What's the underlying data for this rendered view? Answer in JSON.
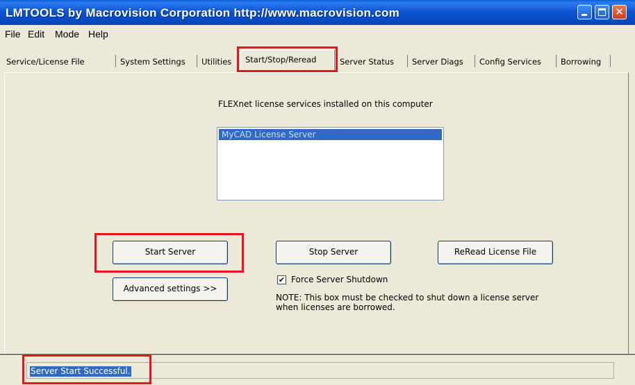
{
  "window": {
    "title": "LMTOOLS by Macrovision Corporation http://www.macrovision.com",
    "controls": [
      "minimize-icon",
      "maximize-icon",
      "close-icon"
    ]
  },
  "menu": [
    "File",
    "Edit",
    "Mode",
    "Help"
  ],
  "tabs": [
    {
      "label": "Service/License File"
    },
    {
      "label": "System Settings"
    },
    {
      "label": "Utilities"
    },
    {
      "label": "Start/Stop/Reread",
      "active": true
    },
    {
      "label": "Server Status"
    },
    {
      "label": "Server Diags"
    },
    {
      "label": "Config Services"
    },
    {
      "label": "Borrowing"
    }
  ],
  "main": {
    "services_caption": "FLEXnet license services installed on this computer",
    "services": [
      "MyCAD License Server"
    ],
    "selected_service": "MyCAD License Server",
    "start_button": "Start Server",
    "stop_button": "Stop Server",
    "reread_button": "ReRead License File",
    "advanced_button": "Advanced settings >>",
    "force_shutdown": {
      "label": "Force Server Shutdown",
      "checked": true,
      "glyph": "✔"
    },
    "note_line1": "NOTE:  This box must be checked to shut down a license server",
    "note_line2": "when licenses are borrowed."
  },
  "status": {
    "text": "Server Start Successful."
  },
  "colors": {
    "title_bar": "#0a52d0",
    "highlight_box": "#e8141c",
    "selection": "#316ac5",
    "window_bg": "#ece9d8"
  }
}
